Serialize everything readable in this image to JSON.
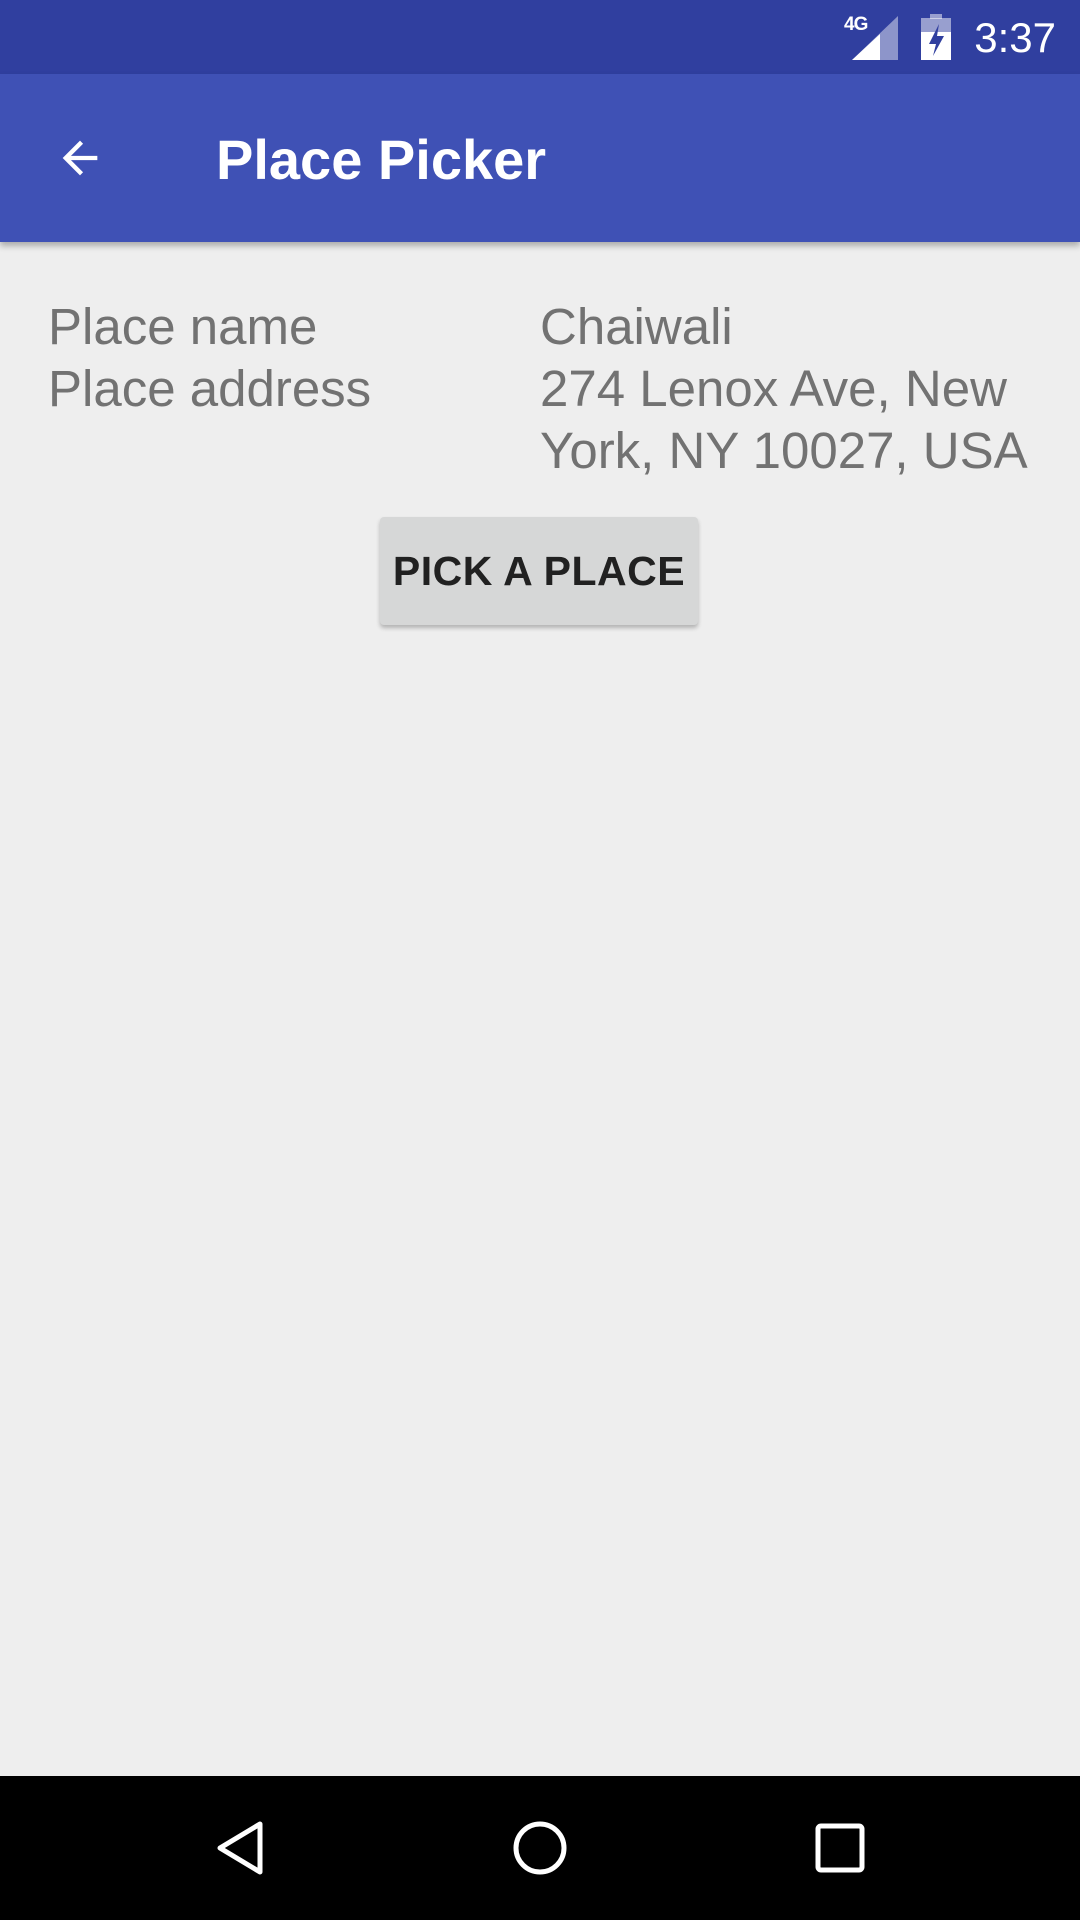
{
  "status_bar": {
    "network": "4G",
    "time": "3:37",
    "icons": [
      "signal-icon",
      "battery-charging-icon"
    ]
  },
  "app_bar": {
    "title": "Place Picker",
    "back_icon": "arrow-back-icon"
  },
  "details": {
    "name_label": "Place name",
    "name_value": "Chaiwali",
    "address_label": "Place address",
    "address_value": "274 Lenox Ave, New York, NY 10027, USA"
  },
  "actions": {
    "pick_label": "PICK A PLACE"
  },
  "nav_bar": {
    "icons": [
      "nav-back-icon",
      "nav-home-icon",
      "nav-recents-icon"
    ]
  },
  "colors": {
    "status_bar": "#303f9f",
    "app_bar": "#3f51b5",
    "background": "#eeeeee",
    "text": "#727272",
    "button": "#d6d7d7"
  }
}
